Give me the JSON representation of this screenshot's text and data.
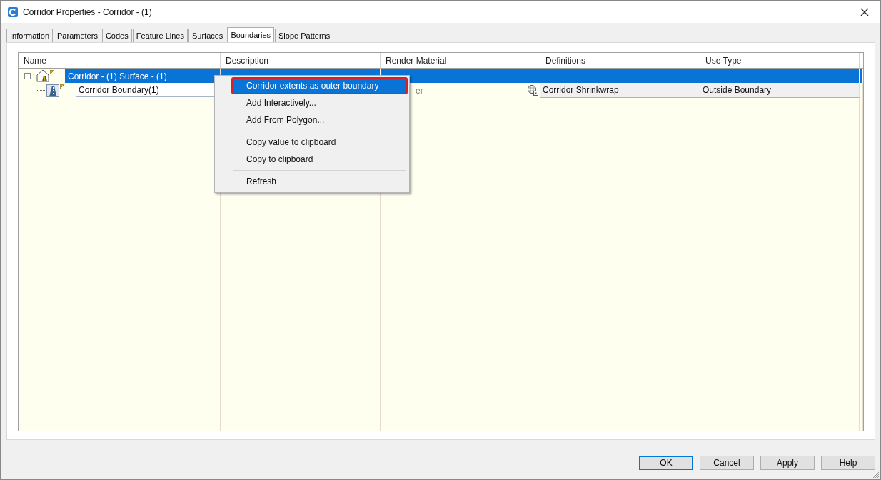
{
  "window": {
    "title": "Corridor Properties - Corridor - (1)"
  },
  "tabs": [
    {
      "label": "Information",
      "selected": false
    },
    {
      "label": "Parameters",
      "selected": false
    },
    {
      "label": "Codes",
      "selected": false
    },
    {
      "label": "Feature Lines",
      "selected": false
    },
    {
      "label": "Surfaces",
      "selected": false
    },
    {
      "label": "Boundaries",
      "selected": true
    },
    {
      "label": "Slope Patterns",
      "selected": false
    }
  ],
  "grid": {
    "columns": [
      "Name",
      "Description",
      "Render Material",
      "Definitions",
      "Use Type"
    ],
    "rows": [
      {
        "name": "Corridor - (1) Surface - (1)",
        "selected": true,
        "expanded": true,
        "children": [
          {
            "name": "Corridor Boundary(1)",
            "selected": false,
            "render_material": "er",
            "definitions": "Corridor Shrinkwrap",
            "use_type": "Outside Boundary"
          }
        ]
      }
    ]
  },
  "context_menu": {
    "groups": [
      [
        {
          "label": "Corridor extents as outer boundary",
          "selected": true
        },
        {
          "label": "Add Interactively...",
          "selected": false
        },
        {
          "label": "Add From Polygon...",
          "selected": false
        }
      ],
      [
        {
          "label": "Copy value to clipboard",
          "selected": false
        },
        {
          "label": "Copy to clipboard",
          "selected": false
        }
      ],
      [
        {
          "label": "Refresh",
          "selected": false
        }
      ]
    ]
  },
  "buttons": [
    {
      "label": "OK",
      "default": true
    },
    {
      "label": "Cancel",
      "default": false
    },
    {
      "label": "Apply",
      "default": false
    },
    {
      "label": "Help",
      "default": false
    }
  ]
}
